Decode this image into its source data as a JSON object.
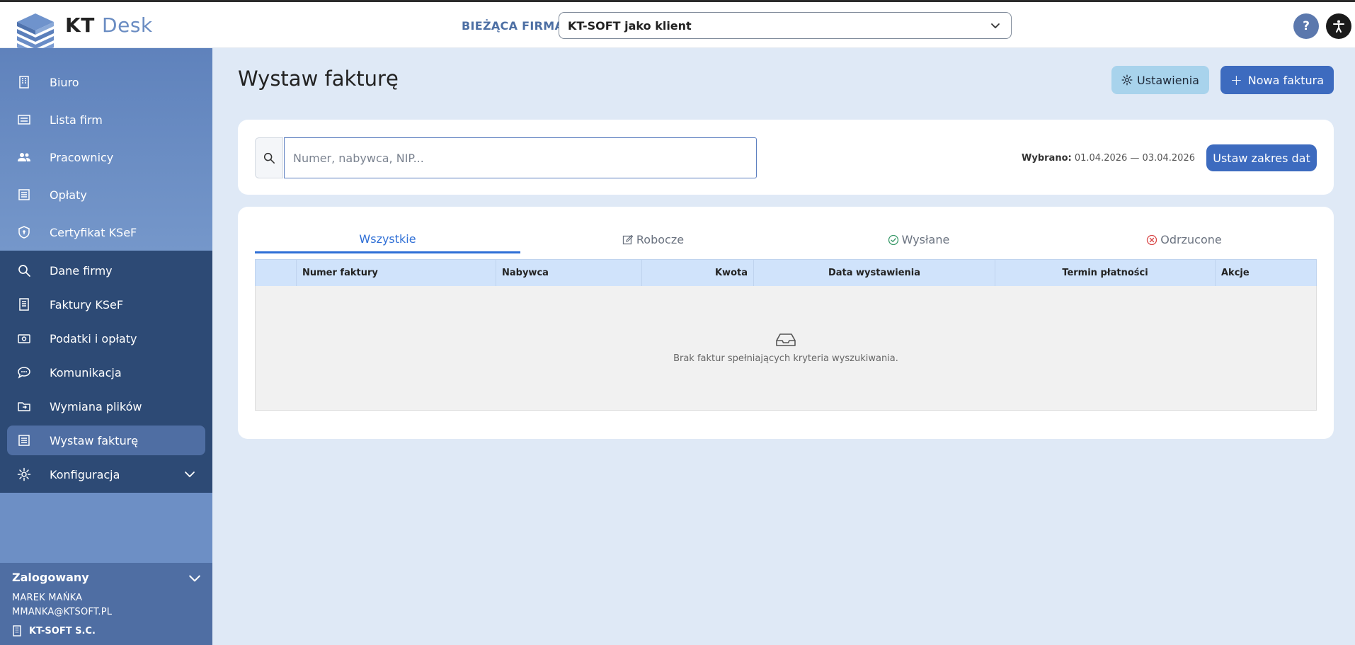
{
  "header": {
    "brand_kt": "KT",
    "brand_desk": "Desk",
    "firm_label": "BIEŻĄCA FIRMA:",
    "firm_value": "KT-SOFT jako klient",
    "help_label": "?"
  },
  "sidebar": {
    "items": [
      {
        "label": "Biuro",
        "icon": "building-icon"
      },
      {
        "label": "Lista firm",
        "icon": "list-icon"
      },
      {
        "label": "Pracownicy",
        "icon": "users-icon"
      },
      {
        "label": "Opłaty",
        "icon": "receipt-icon"
      },
      {
        "label": "Certyfikat KSeF",
        "icon": "shield-icon"
      },
      {
        "label": "Dane firmy",
        "icon": "search-icon"
      },
      {
        "label": "Faktury KSeF",
        "icon": "document-icon"
      },
      {
        "label": "Podatki i opłaty",
        "icon": "cash-icon"
      },
      {
        "label": "Komunikacja",
        "icon": "chat-icon"
      },
      {
        "label": "Wymiana plików",
        "icon": "folder-icon"
      },
      {
        "label": "Wystaw fakturę",
        "icon": "invoice-icon"
      },
      {
        "label": "Konfiguracja",
        "icon": "gear-icon"
      }
    ],
    "logged": {
      "title": "Zalogowany",
      "name": "MAREK MAŃKA",
      "email": "MMANKA@KTSOFT.PL",
      "firm": "KT-SOFT S.C."
    }
  },
  "main": {
    "title": "Wystaw fakturę",
    "settings_label": "Ustawienia",
    "new_label": "Nowa faktura",
    "search_placeholder": "Numer, nabywca, NIP...",
    "date_label": "Wybrano:",
    "date_value": "01.04.2026 — 03.04.2026",
    "range_label": "Ustaw zakres dat",
    "tabs": [
      {
        "label": "Wszystkie",
        "active": true
      },
      {
        "label": "Robocze"
      },
      {
        "label": "Wysłane"
      },
      {
        "label": "Odrzucone"
      }
    ],
    "columns": [
      "",
      "Numer faktury",
      "Nabywca",
      "Kwota",
      "Data wystawienia",
      "Termin płatności",
      "Akcje"
    ],
    "empty_message": "Brak faktur spełniających kryteria wyszukiwania."
  },
  "colors": {
    "accent": "#3d6bbf",
    "sidebar_dark": "#2d4a75",
    "sidebar_light": "#6d8fc5",
    "tab_active": "#2f6fd6"
  }
}
